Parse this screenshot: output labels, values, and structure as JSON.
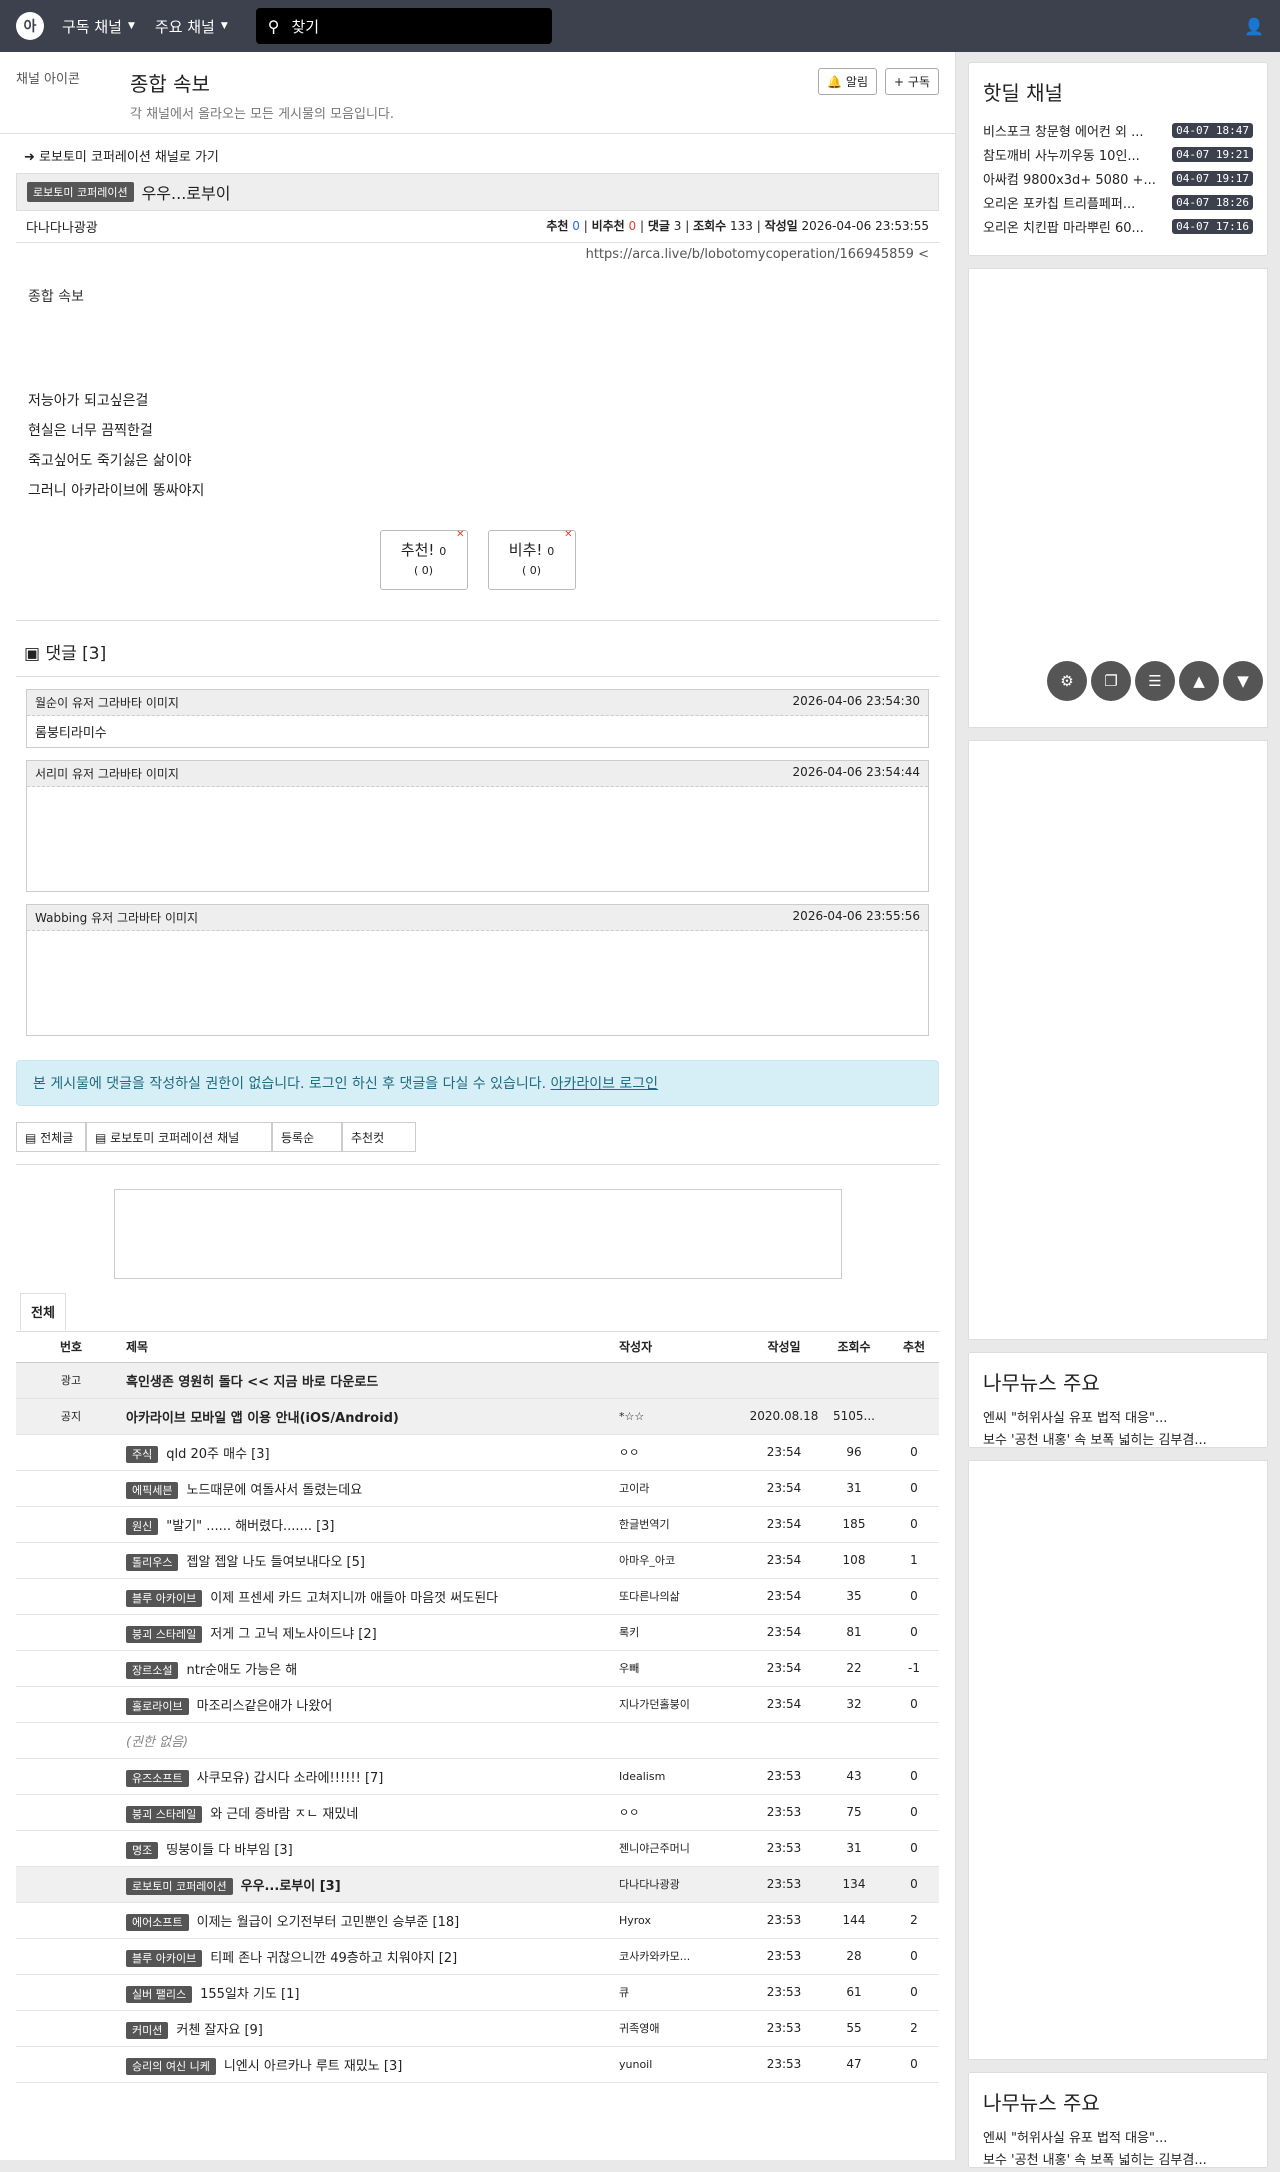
{
  "nav": {
    "logo": "아",
    "menu1": "구독 채널",
    "menu2": "주요 채널",
    "search_placeholder": "찾기"
  },
  "board": {
    "icon_alt": "채널 아이콘",
    "title": "종합 속보",
    "desc": "각 채널에서 올라오는 모든 게시물의 모음입니다.",
    "btn_alarm": "알림",
    "btn_subscribe": "구독"
  },
  "article": {
    "back": "로보토미 코퍼레이션 채널로 가기",
    "category": "로보토미 코퍼레이션",
    "title": "우우...로부이",
    "author": "다나다나광광",
    "meta": {
      "upvote_label": "추천",
      "upvote": "0",
      "downvote_label": "비추천",
      "downvote": "0",
      "comment_label": "댓글",
      "comments": "3",
      "views_label": "조회수",
      "views": "133",
      "date_label": "작성일",
      "date": "2026-04-06 23:53:55"
    },
    "url": "https://arca.live/b/lobotomycoperation/166945859",
    "image_alt": "종합 속보",
    "lines": [
      "저능아가 되고싶은걸",
      "현실은 너무 끔찍한걸",
      "죽고싶어도 죽기싫은 삶이야",
      "",
      "그러니 아카라이브에 똥싸야지"
    ],
    "vote_up": "추천!",
    "vote_up_count": "0",
    "vote_up_sub": "( 0)",
    "vote_down": "비추!",
    "vote_down_count": "0",
    "vote_down_sub": "( 0)"
  },
  "comments": {
    "heading": "댓글 [3]",
    "avatar_alt": "유저 그라바타 이미지",
    "items": [
      {
        "author": "월순이",
        "date": "2026-04-06 23:54:30",
        "text": "롬붕티라미수"
      },
      {
        "author": "서리미",
        "date": "2026-04-06 23:54:44",
        "text": ""
      },
      {
        "author": "Wabbing",
        "date": "2026-04-06 23:55:56",
        "text": ""
      }
    ]
  },
  "notice": {
    "text": "본 게시물에 댓글을 작성하실 권한이 없습니다. 로그인 하신 후 댓글을 다실 수 있습니다.",
    "link": "아카라이브 로그인"
  },
  "filters": {
    "all": "전체글",
    "channel": "로보토미 코퍼레이션 채널",
    "sort": "등록순",
    "best": "추천컷"
  },
  "list": {
    "tab": "전체",
    "headers": [
      "번호",
      "제목",
      "작성자",
      "작성일",
      "조회수",
      "추천"
    ],
    "rows": [
      {
        "no": "광고",
        "badge": "",
        "title": "흑인생존 영원히 돌다 << 지금 바로 다운로드",
        "author": "",
        "date": "",
        "views": "",
        "up": "",
        "gray": true
      },
      {
        "no": "공지",
        "badge": "",
        "title": "아카라이브 모바일 앱 이용 안내(iOS/Android)",
        "author": "*☆☆",
        "date": "2020.08.18",
        "views": "5105...",
        "up": "",
        "gray": true
      },
      {
        "no": "",
        "badge": "주식",
        "title": "qld 20주 매수 [3]",
        "author": "ㅇㅇ",
        "date": "23:54",
        "views": "96",
        "up": "0"
      },
      {
        "no": "",
        "badge": "에픽세븐",
        "title": "노드때문에 여돌사서 돌렸는데요",
        "author": "고이라",
        "date": "23:54",
        "views": "31",
        "up": "0"
      },
      {
        "no": "",
        "badge": "원신",
        "title": "\"발기\" ...... 해버렸다....... [3]",
        "author": "한글번역기",
        "date": "23:54",
        "views": "185",
        "up": "0"
      },
      {
        "no": "",
        "badge": "톨리우스",
        "title": "젭알 젭알 나도 들여보내다오 [5]",
        "author": "아마우_아코",
        "date": "23:54",
        "views": "108",
        "up": "1"
      },
      {
        "no": "",
        "badge": "블루 아카이브",
        "title": "이제 프센세 카드 고쳐지니까 애들아 마음껏 써도된다",
        "author": "또다른나의삶",
        "date": "23:54",
        "views": "35",
        "up": "0"
      },
      {
        "no": "",
        "badge": "붕괴 스타레일",
        "title": "저게 그 고닉 제노사이드냐 [2]",
        "author": "록키",
        "date": "23:54",
        "views": "81",
        "up": "0"
      },
      {
        "no": "",
        "badge": "장르소설",
        "title": "ntr순애도 가능은 해",
        "author": "우빼",
        "date": "23:54",
        "views": "22",
        "up": "-1"
      },
      {
        "no": "",
        "badge": "홀로라이브",
        "title": "마조리스같은애가 나왔어",
        "author": "지나가던홀붕이",
        "date": "23:54",
        "views": "32",
        "up": "0"
      },
      {
        "no": "",
        "badge": "",
        "title": "(권한 없음)",
        "author": "",
        "date": "",
        "views": "",
        "up": ""
      },
      {
        "no": "",
        "badge": "유즈소프트",
        "title": "사쿠모유) 갑시다 소라에!!!!!! [7]",
        "author": "Idealism",
        "date": "23:53",
        "views": "43",
        "up": "0"
      },
      {
        "no": "",
        "badge": "붕괴 스타레일",
        "title": "와 근데 증바람 ㅈㄴ 재밌네",
        "author": "ㅇㅇ",
        "date": "23:53",
        "views": "75",
        "up": "0"
      },
      {
        "no": "",
        "badge": "명조",
        "title": "띵붕이들 다 바부임 [3]",
        "author": "젠니야근주머니",
        "date": "23:53",
        "views": "31",
        "up": "0"
      },
      {
        "no": "",
        "badge": "로보토미 코퍼레이션",
        "title": "우우...로부이 [3]",
        "author": "다나다나광광",
        "date": "23:53",
        "views": "134",
        "up": "0",
        "gray": true
      },
      {
        "no": "",
        "badge": "에어소프트",
        "title": "이제는 월급이 오기전부터 고민뿐인 승부준 [18]",
        "author": "Hyrox",
        "date": "23:53",
        "views": "144",
        "up": "2"
      },
      {
        "no": "",
        "badge": "블루 아카이브",
        "title": "티페 존나 귀찮으니깐 49층하고 치워야지 [2]",
        "author": "코사카와카모...",
        "date": "23:53",
        "views": "28",
        "up": "0"
      },
      {
        "no": "",
        "badge": "실버 팰리스",
        "title": "155일차 기도 [1]",
        "author": "큐",
        "date": "23:53",
        "views": "61",
        "up": "0"
      },
      {
        "no": "",
        "badge": "커미션",
        "title": "커첸 잘자요 [9]",
        "author": "귀족영애",
        "date": "23:53",
        "views": "55",
        "up": "2"
      },
      {
        "no": "",
        "badge": "승리의 여신 니케",
        "title": "니엔시 아르카나 루트 재밌노 [3]",
        "author": "yunoil",
        "date": "23:53",
        "views": "47",
        "up": "0"
      }
    ]
  },
  "side": {
    "hot_title": "핫딜 채널",
    "hot": [
      {
        "t": "비스포크 창문형 에어컨 외 ...",
        "d": "04-07 18:47"
      },
      {
        "t": "참도깨비 사누끼우동 10인...",
        "d": "04-07 19:21"
      },
      {
        "t": "아싸컴 9800x3d+ 5080 +...",
        "d": "04-07 19:17"
      },
      {
        "t": "오리온 포카칩 트리플페퍼...",
        "d": "04-07 18:26"
      },
      {
        "t": "오리온 치킨팝 마라뿌린 60...",
        "d": "04-07 17:16"
      }
    ],
    "news_title": "나무뉴스 주요",
    "news": [
      "엔씨 \"허위사실 유포 법적 대응\"...",
      "보수 '공천 내홍' 속 보폭 넓히는 김부겸..."
    ]
  },
  "colors": {
    "nav": "#3d414d",
    "accent_blue": "#2d6cdf",
    "accent_red": "#d43",
    "notice_bg": "#d6eef5"
  },
  "icons": [
    "logo-icon",
    "search-icon",
    "user-icon",
    "bell-icon",
    "plus-icon",
    "share-icon",
    "settings-icon",
    "copy-icon",
    "list-icon",
    "arrow-up-icon",
    "arrow-down-icon"
  ]
}
